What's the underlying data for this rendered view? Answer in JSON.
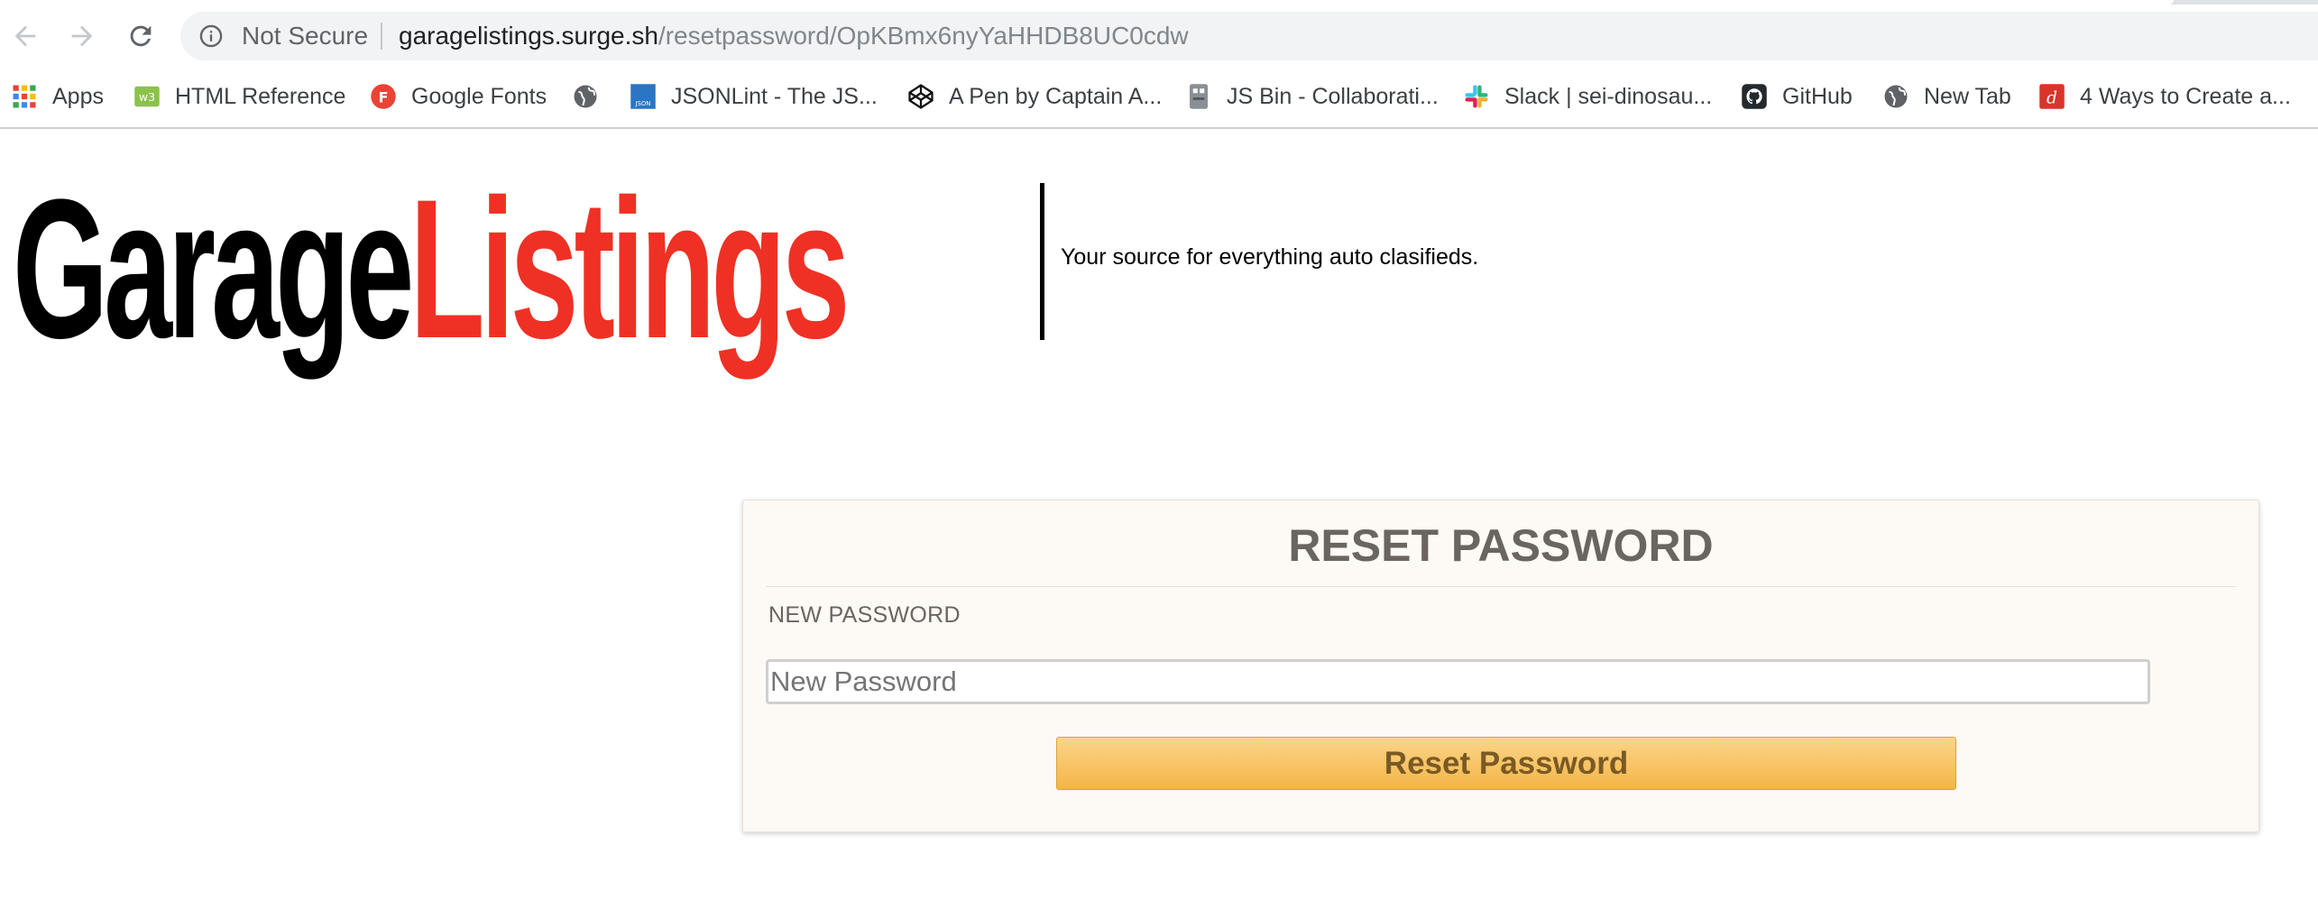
{
  "browser": {
    "security_label": "Not Secure",
    "url_host": "garagelistings.surge.sh",
    "url_path": "/resetpassword/OpKBmx6nyYaHHDB8UC0cdw"
  },
  "bookmarks": [
    {
      "label": "Apps",
      "icon": "apps-grid-icon"
    },
    {
      "label": "HTML Reference",
      "icon": "w3-icon"
    },
    {
      "label": "Google Fonts",
      "icon": "google-fonts-icon"
    },
    {
      "label": "",
      "icon": "globe-icon"
    },
    {
      "label": "JSONLint - The JS...",
      "icon": "jsonlint-icon"
    },
    {
      "label": "A Pen by Captain A...",
      "icon": "codepen-icon"
    },
    {
      "label": "JS Bin - Collaborati...",
      "icon": "jsbin-icon"
    },
    {
      "label": "Slack | sei-dinosau...",
      "icon": "slack-icon"
    },
    {
      "label": "GitHub",
      "icon": "github-icon"
    },
    {
      "label": "New Tab",
      "icon": "globe-icon"
    },
    {
      "label": "4 Ways to Create a...",
      "icon": "dev-icon"
    }
  ],
  "header": {
    "logo_part1": "Garage",
    "logo_part2": "Listings",
    "tagline": "Your source for everything auto clasifieds."
  },
  "reset_form": {
    "title": "RESET PASSWORD",
    "field_label": "NEW PASSWORD",
    "input_placeholder": "New Password",
    "input_value": "",
    "submit_label": "Reset Password"
  },
  "colors": {
    "logo_black": "#000000",
    "logo_red": "#ee3124",
    "button_top": "#fbd58a",
    "button_bottom": "#f5b547",
    "card_bg": "#fdf9f5"
  }
}
